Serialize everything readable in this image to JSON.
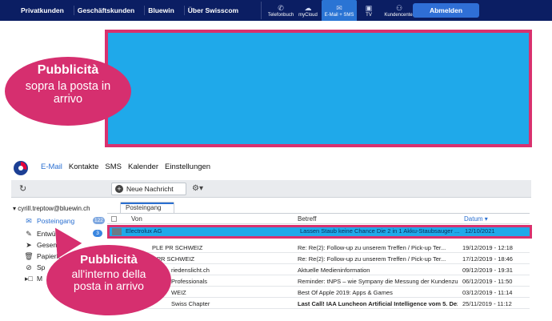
{
  "topnav": {
    "left_links": [
      "Privatkunden",
      "Geschäftskunden",
      "Bluewin",
      "Über Swisscom"
    ],
    "services": [
      {
        "label": "Telefonbuch",
        "icon": "phone-icon"
      },
      {
        "label": "myCloud",
        "icon": "cloud-icon"
      },
      {
        "label": "E-Mail + SMS",
        "icon": "mail-icon",
        "active": true
      },
      {
        "label": "TV",
        "icon": "tv-icon"
      },
      {
        "label": "Kundencenter",
        "icon": "people-icon"
      }
    ],
    "logout_label": "Abmelden"
  },
  "callouts": {
    "top": {
      "title": "Pubblicità",
      "text": "sopra la posta in arrivo"
    },
    "inline": {
      "title": "Pubblicità",
      "text": "all'interno della posta in arrivo"
    }
  },
  "mailnav": {
    "items": [
      "E-Mail",
      "Kontakte",
      "SMS",
      "Kalender",
      "Einstellungen"
    ]
  },
  "toolbar": {
    "new_message": "Neue Nachricht"
  },
  "sidebar": {
    "account": "cyrill.treptow@bluewin.ch",
    "folders": [
      {
        "label": "Posteingang",
        "badge": "122",
        "icon": "inbox-icon"
      },
      {
        "label": "Entwürfe",
        "badge": "3",
        "icon": "drafts-icon"
      },
      {
        "label": "Gesendet",
        "icon": "sent-icon"
      },
      {
        "label": "Papierk",
        "icon": "trash-icon"
      },
      {
        "label": "Sp",
        "icon": "spam-icon"
      },
      {
        "label": "M",
        "icon": "folder-icon"
      }
    ]
  },
  "list": {
    "tab": "Posteingang",
    "columns": {
      "from": "Von",
      "subject": "Betreff",
      "date": "Datum"
    },
    "rows": [
      {
        "from": "Electrolux AG",
        "subject": "Lassen Staub keine Chance Die 2 in 1 Akku-Staubsauger ...",
        "date": "12/10/2021",
        "ad": true
      },
      {
        "from": "PLE PR SCHWEIZ",
        "subject": "Re: Re(2): Follow-up zu unserem Treffen / Pick-up Ter...",
        "date": "19/12/2019 - 12:18"
      },
      {
        "from": "PR SCHWEIZ",
        "subject": "Re: Re(2): Follow-up zu unserem Treffen / Pick-up Ter...",
        "date": "17/12/2019 - 18:46"
      },
      {
        "from": "riedenslicht.ch",
        "subject": "Aktuelle Medieninformation",
        "date": "09/12/2019 - 19:31"
      },
      {
        "from": "Professionals",
        "subject": "Reminder: tNPS – wie Sympany die Messung der Kundenzu...",
        "date": "06/12/2019 - 11:50"
      },
      {
        "from": "WEIZ",
        "subject": "Best Of Apple 2019: Apps & Games",
        "date": "03/12/2019 - 11:14"
      },
      {
        "from": "Swiss Chapter",
        "subject": "Last Call! IAA Luncheon Artificial Intelligence vom 5. Deze...",
        "date": "25/11/2019 - 11:12",
        "bold": true
      }
    ]
  },
  "colors": {
    "nav_bg": "#0b1e63",
    "accent": "#2a6fd1",
    "ad_fill": "#1fa9ea",
    "callout": "#d62f6f"
  }
}
